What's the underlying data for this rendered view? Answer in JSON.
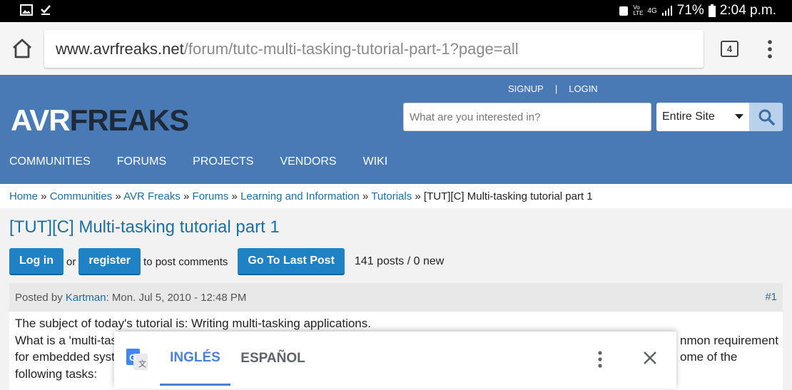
{
  "status": {
    "battery": "71%",
    "time": "2:04 p.m."
  },
  "browser": {
    "url_host": "www.avrfreaks.net",
    "url_path": "/forum/tutc-multi-tasking-tutorial-part-1?page=all",
    "tab_count": "4"
  },
  "header": {
    "signup": "SIGNUP",
    "separator": "|",
    "login": "LOGIN",
    "logo_part1": "AVR",
    "logo_part2": "FREAKS",
    "search_placeholder": "What are you interested in?",
    "search_scope": "Entire Site",
    "nav": [
      "COMMUNITIES",
      "FORUMS",
      "PROJECTS",
      "VENDORS",
      "WIKI"
    ]
  },
  "breadcrumb": {
    "items": [
      "Home",
      "Communities",
      "AVR Freaks",
      "Forums",
      "Learning and Information",
      "Tutorials"
    ],
    "current": "[TUT][C] Multi-tasking tutorial part 1",
    "sep": " » "
  },
  "topic": {
    "title": "[TUT][C] Multi-tasking tutorial part 1",
    "login_btn": "Log in",
    "or_text": "or",
    "register_btn": "register",
    "post_comments_text": "to post comments",
    "last_post_btn": "Go To Last Post",
    "post_count": "141 posts / 0 new"
  },
  "post": {
    "posted_by": "Posted by",
    "author": "Kartman",
    "date": ": Mon. Jul 5, 2010 - 12:48 PM",
    "number": "#1",
    "line1": "The subject of today's tutorial is: Writing multi-tasking applications.",
    "line2_start": "What is a 'multi-tas",
    "line2_end": "nmon requirement",
    "line3_start": "for embedded syst",
    "line3_end": "ome of the",
    "line4": "following tasks:"
  },
  "translate": {
    "tab_active": "INGLÉS",
    "tab_other": "ESPAÑOL"
  }
}
